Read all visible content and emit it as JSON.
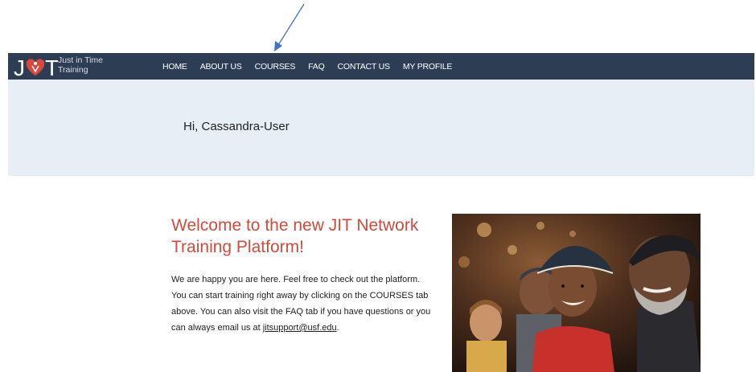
{
  "brand": {
    "line1": "Just in Time",
    "line2": "Training",
    "accent": "#d9483b",
    "nav_bg": "#2d3e54"
  },
  "nav": {
    "items": [
      {
        "label": "HOME"
      },
      {
        "label": "ABOUT US"
      },
      {
        "label": "COURSES"
      },
      {
        "label": "FAQ"
      },
      {
        "label": "CONTACT US"
      },
      {
        "label": "MY PROFILE"
      }
    ]
  },
  "hero": {
    "greeting": "Hi, Cassandra-User",
    "bg": "#e8eef6"
  },
  "welcome": {
    "title": "Welcome to the new JIT Network Training Platform!",
    "body_text": "We are happy you are here. Feel free to check out the platform. You can start training right away by clicking on the COURSES tab above. You can also visit the FAQ tab if you have questions or you can always email us at ",
    "email": "jitsupport@usf.edu",
    "body_end": "."
  },
  "annotation": {
    "arrow_color": "#4472c4"
  }
}
